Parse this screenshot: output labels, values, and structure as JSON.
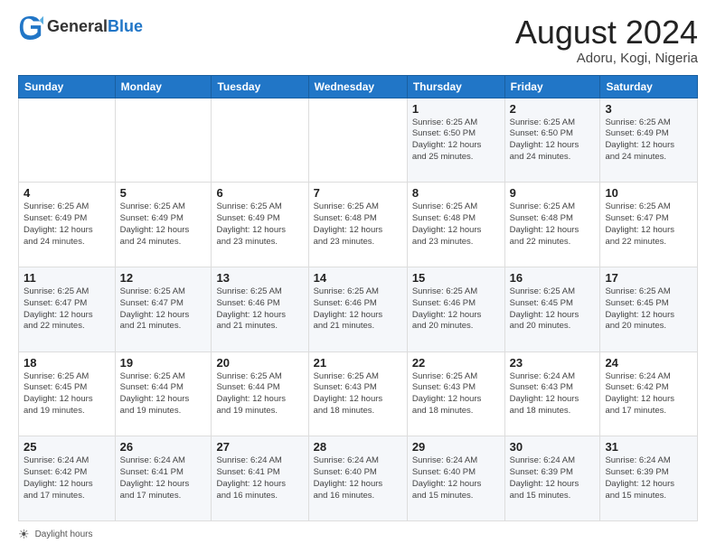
{
  "header": {
    "logo": {
      "general": "General",
      "blue": "Blue"
    },
    "title": "August 2024",
    "location": "Adoru, Kogi, Nigeria"
  },
  "calendar": {
    "days_of_week": [
      "Sunday",
      "Monday",
      "Tuesday",
      "Wednesday",
      "Thursday",
      "Friday",
      "Saturday"
    ],
    "weeks": [
      [
        {
          "day": "",
          "info": ""
        },
        {
          "day": "",
          "info": ""
        },
        {
          "day": "",
          "info": ""
        },
        {
          "day": "",
          "info": ""
        },
        {
          "day": "1",
          "info": "Sunrise: 6:25 AM\nSunset: 6:50 PM\nDaylight: 12 hours\nand 25 minutes."
        },
        {
          "day": "2",
          "info": "Sunrise: 6:25 AM\nSunset: 6:50 PM\nDaylight: 12 hours\nand 24 minutes."
        },
        {
          "day": "3",
          "info": "Sunrise: 6:25 AM\nSunset: 6:49 PM\nDaylight: 12 hours\nand 24 minutes."
        }
      ],
      [
        {
          "day": "4",
          "info": "Sunrise: 6:25 AM\nSunset: 6:49 PM\nDaylight: 12 hours\nand 24 minutes."
        },
        {
          "day": "5",
          "info": "Sunrise: 6:25 AM\nSunset: 6:49 PM\nDaylight: 12 hours\nand 24 minutes."
        },
        {
          "day": "6",
          "info": "Sunrise: 6:25 AM\nSunset: 6:49 PM\nDaylight: 12 hours\nand 23 minutes."
        },
        {
          "day": "7",
          "info": "Sunrise: 6:25 AM\nSunset: 6:48 PM\nDaylight: 12 hours\nand 23 minutes."
        },
        {
          "day": "8",
          "info": "Sunrise: 6:25 AM\nSunset: 6:48 PM\nDaylight: 12 hours\nand 23 minutes."
        },
        {
          "day": "9",
          "info": "Sunrise: 6:25 AM\nSunset: 6:48 PM\nDaylight: 12 hours\nand 22 minutes."
        },
        {
          "day": "10",
          "info": "Sunrise: 6:25 AM\nSunset: 6:47 PM\nDaylight: 12 hours\nand 22 minutes."
        }
      ],
      [
        {
          "day": "11",
          "info": "Sunrise: 6:25 AM\nSunset: 6:47 PM\nDaylight: 12 hours\nand 22 minutes."
        },
        {
          "day": "12",
          "info": "Sunrise: 6:25 AM\nSunset: 6:47 PM\nDaylight: 12 hours\nand 21 minutes."
        },
        {
          "day": "13",
          "info": "Sunrise: 6:25 AM\nSunset: 6:46 PM\nDaylight: 12 hours\nand 21 minutes."
        },
        {
          "day": "14",
          "info": "Sunrise: 6:25 AM\nSunset: 6:46 PM\nDaylight: 12 hours\nand 21 minutes."
        },
        {
          "day": "15",
          "info": "Sunrise: 6:25 AM\nSunset: 6:46 PM\nDaylight: 12 hours\nand 20 minutes."
        },
        {
          "day": "16",
          "info": "Sunrise: 6:25 AM\nSunset: 6:45 PM\nDaylight: 12 hours\nand 20 minutes."
        },
        {
          "day": "17",
          "info": "Sunrise: 6:25 AM\nSunset: 6:45 PM\nDaylight: 12 hours\nand 20 minutes."
        }
      ],
      [
        {
          "day": "18",
          "info": "Sunrise: 6:25 AM\nSunset: 6:45 PM\nDaylight: 12 hours\nand 19 minutes."
        },
        {
          "day": "19",
          "info": "Sunrise: 6:25 AM\nSunset: 6:44 PM\nDaylight: 12 hours\nand 19 minutes."
        },
        {
          "day": "20",
          "info": "Sunrise: 6:25 AM\nSunset: 6:44 PM\nDaylight: 12 hours\nand 19 minutes."
        },
        {
          "day": "21",
          "info": "Sunrise: 6:25 AM\nSunset: 6:43 PM\nDaylight: 12 hours\nand 18 minutes."
        },
        {
          "day": "22",
          "info": "Sunrise: 6:25 AM\nSunset: 6:43 PM\nDaylight: 12 hours\nand 18 minutes."
        },
        {
          "day": "23",
          "info": "Sunrise: 6:24 AM\nSunset: 6:43 PM\nDaylight: 12 hours\nand 18 minutes."
        },
        {
          "day": "24",
          "info": "Sunrise: 6:24 AM\nSunset: 6:42 PM\nDaylight: 12 hours\nand 17 minutes."
        }
      ],
      [
        {
          "day": "25",
          "info": "Sunrise: 6:24 AM\nSunset: 6:42 PM\nDaylight: 12 hours\nand 17 minutes."
        },
        {
          "day": "26",
          "info": "Sunrise: 6:24 AM\nSunset: 6:41 PM\nDaylight: 12 hours\nand 17 minutes."
        },
        {
          "day": "27",
          "info": "Sunrise: 6:24 AM\nSunset: 6:41 PM\nDaylight: 12 hours\nand 16 minutes."
        },
        {
          "day": "28",
          "info": "Sunrise: 6:24 AM\nSunset: 6:40 PM\nDaylight: 12 hours\nand 16 minutes."
        },
        {
          "day": "29",
          "info": "Sunrise: 6:24 AM\nSunset: 6:40 PM\nDaylight: 12 hours\nand 15 minutes."
        },
        {
          "day": "30",
          "info": "Sunrise: 6:24 AM\nSunset: 6:39 PM\nDaylight: 12 hours\nand 15 minutes."
        },
        {
          "day": "31",
          "info": "Sunrise: 6:24 AM\nSunset: 6:39 PM\nDaylight: 12 hours\nand 15 minutes."
        }
      ]
    ]
  },
  "footer": {
    "note": "Daylight hours"
  }
}
